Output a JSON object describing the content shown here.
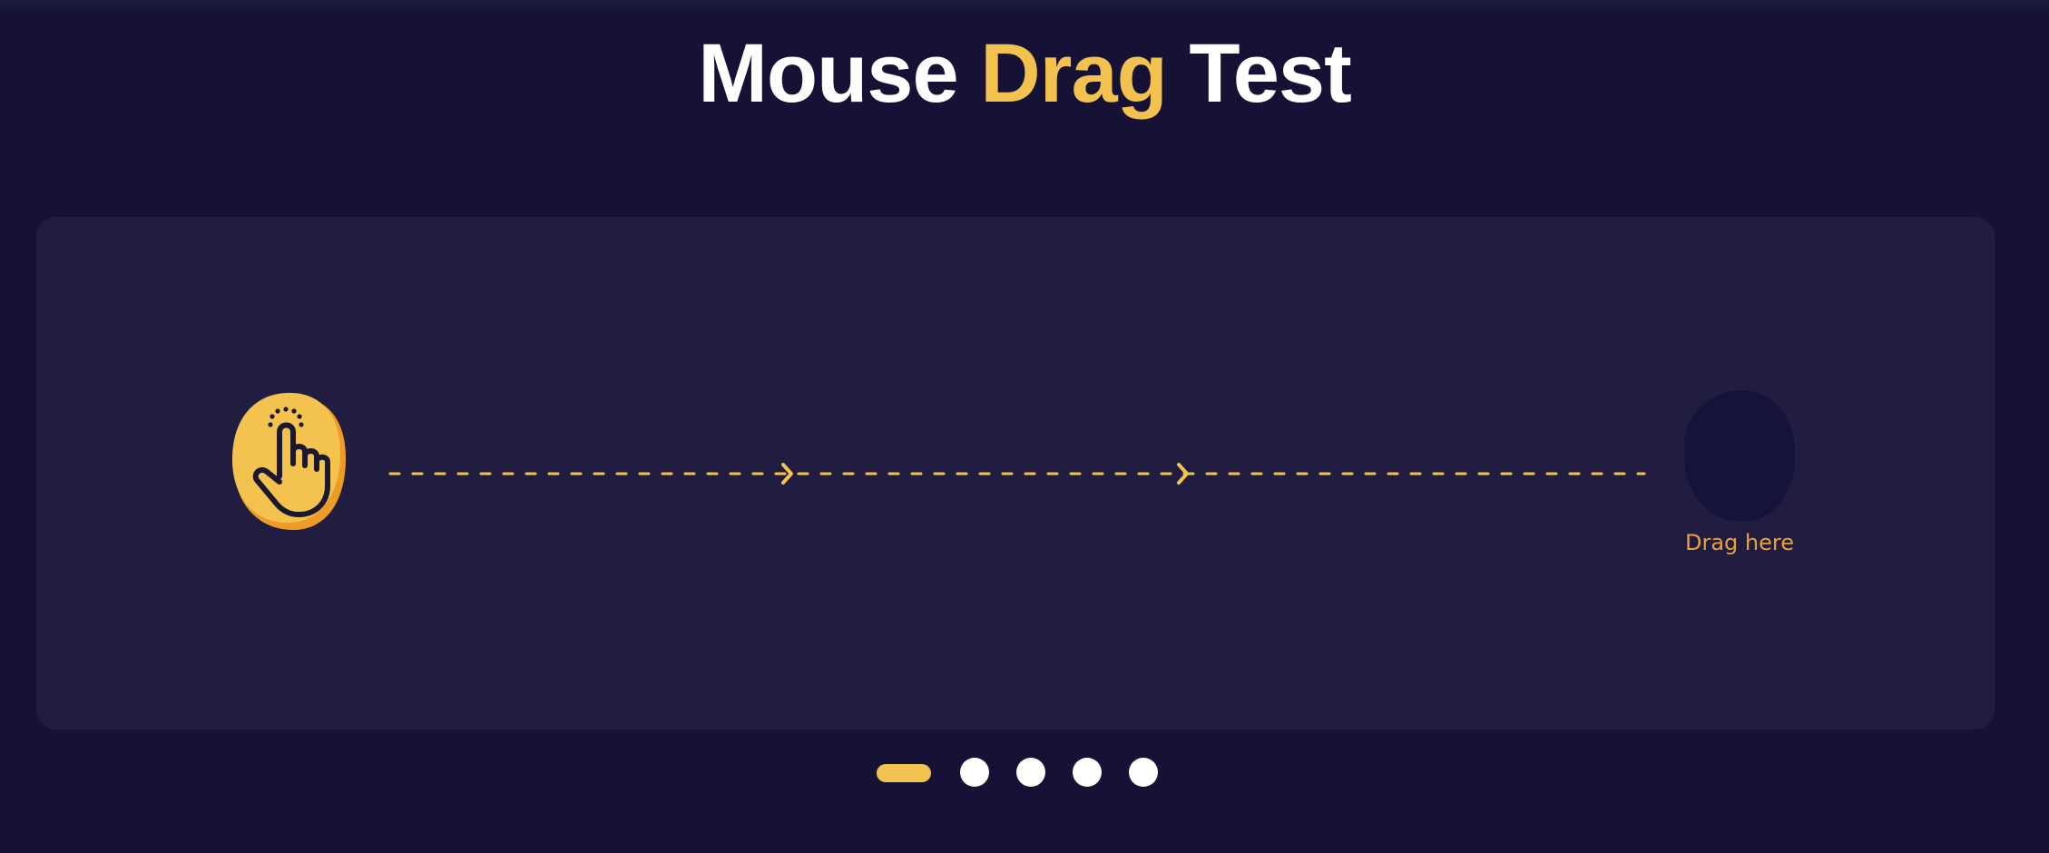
{
  "title": {
    "part1": "Mouse ",
    "accent": "Drag",
    "part2": " Test"
  },
  "drop_target": {
    "label": "Drag here"
  },
  "pagination": {
    "pages": 5,
    "current": 1
  },
  "colors": {
    "background": "#151235",
    "panel": "#201d40",
    "accent": "#f2c14e",
    "accent_dark": "#e9a03b",
    "drop_target": "#16133a",
    "text": "#ffffff"
  },
  "icons": {
    "drag_handle": "tap-hand-icon",
    "track_arrows": "chevron-right-icon"
  }
}
